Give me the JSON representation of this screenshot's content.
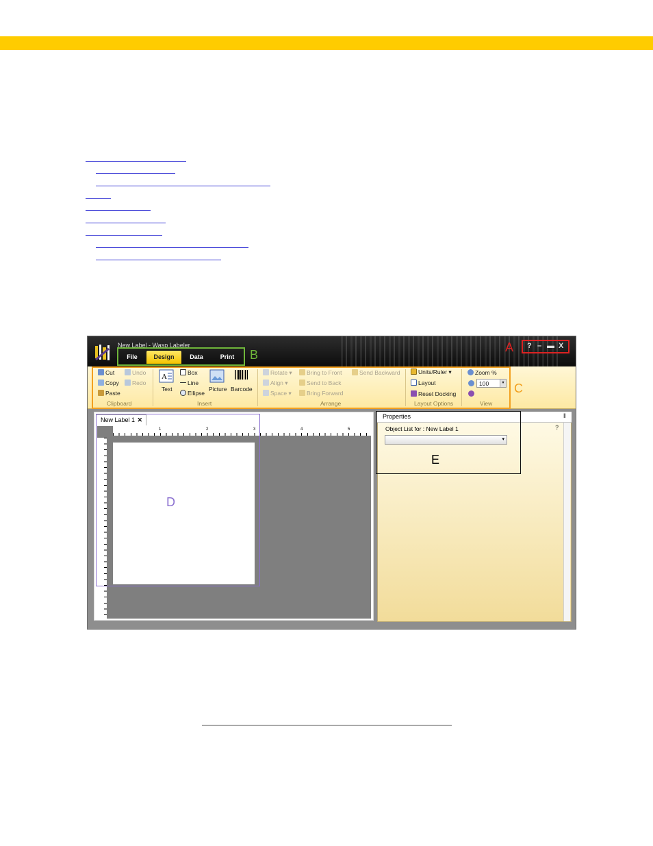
{
  "app": {
    "window_title": "New Label - Wasp Labeler",
    "tabs": [
      {
        "label": "File"
      },
      {
        "label": "Design"
      },
      {
        "label": "Data"
      },
      {
        "label": "Print"
      }
    ],
    "window_buttons": {
      "help": "?",
      "minimize": "–",
      "maximize": "▬",
      "close": "X"
    }
  },
  "annotations": {
    "a": "A",
    "b": "B",
    "c": "C",
    "d": "D",
    "e": "E"
  },
  "ribbon": {
    "clipboard": {
      "cut": "Cut",
      "copy": "Copy",
      "paste": "Paste",
      "undo": "Undo",
      "redo": "Redo",
      "group": "Clipboard"
    },
    "insert": {
      "text": "Text",
      "box": "Box",
      "line": "Line",
      "ellipse": "Ellipse",
      "picture": "Picture",
      "barcode": "Barcode",
      "group": "Insert"
    },
    "arrange": {
      "rotate": "Rotate",
      "align": "Align",
      "space": "Space",
      "bring_to_front": "Bring to Front",
      "send_to_back": "Send to Back",
      "bring_forward": "Bring Forward",
      "send_backward": "Send Backward",
      "group": "Arrange"
    },
    "layout_options": {
      "units_ruler": "Units/Ruler",
      "layout": "Layout",
      "reset_docking": "Reset Docking",
      "group": "Layout Options"
    },
    "view": {
      "zoom": "Zoom %",
      "zoom_value": "100",
      "group": "View"
    }
  },
  "document": {
    "tab_label": "New Label 1",
    "tab_close": "✕",
    "ruler_numbers": [
      "1",
      "2",
      "3",
      "4",
      "5"
    ]
  },
  "properties": {
    "title": "Properties",
    "pin": "‖",
    "object_list_label": "Object List for :  New Label 1",
    "help": "?"
  }
}
